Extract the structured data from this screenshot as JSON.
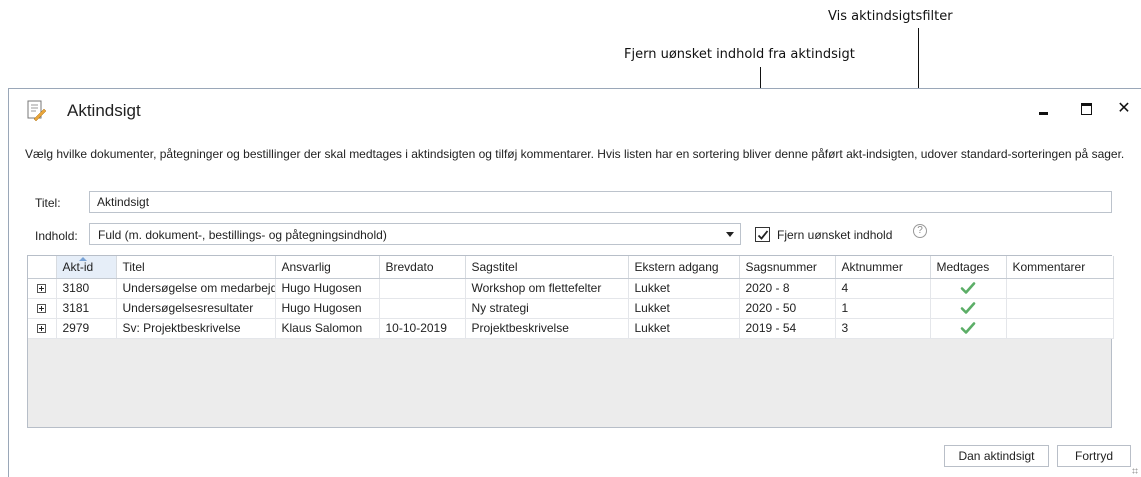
{
  "annotations": {
    "filter_label": "Vis aktindsigtsfilter",
    "remove_label": "Fjern uønsket indhold fra aktindsigt"
  },
  "window": {
    "title": "Aktindsigt",
    "icon": "document-edit-icon",
    "close_glyph": "✕"
  },
  "description": "Vælg hvilke dokumenter, påtegninger og bestillinger der skal medtages i aktindsigten og tilføj kommentarer. Hvis listen har en sortering bliver denne påført akt-indsigten, udover standard-sorteringen på sager.",
  "form": {
    "titel_label": "Titel:",
    "titel_value": "Aktindsigt",
    "indhold_label": "Indhold:",
    "indhold_value": "Fuld (m. dokument-, bestillings- og påtegningsindhold)",
    "remove_checkbox_label": "Fjern uønsket indhold",
    "remove_checked": true,
    "help_glyph": "?"
  },
  "table": {
    "columns": [
      "Akt-id",
      "Titel",
      "Ansvarlig",
      "Brevdato",
      "Sagstitel",
      "Ekstern adgang",
      "Sagsnummer",
      "Aktnummer",
      "Medtages",
      "Kommentarer"
    ],
    "rows": [
      {
        "akt_id": "3180",
        "titel": "Undersøgelse om medarbejdere",
        "ansvarlig": "Hugo Hugosen",
        "brevdato": "",
        "sagstitel": "Workshop om flettefelter",
        "ekstern": "Lukket",
        "sagsnummer": "2020 - 8",
        "aktnummer": "4",
        "medtages": true,
        "kommentarer": ""
      },
      {
        "akt_id": "3181",
        "titel": "Undersøgelsesresultater",
        "ansvarlig": "Hugo Hugosen",
        "brevdato": "",
        "sagstitel": "Ny strategi",
        "ekstern": "Lukket",
        "sagsnummer": "2020 - 50",
        "aktnummer": "1",
        "medtages": true,
        "kommentarer": ""
      },
      {
        "akt_id": "2979",
        "titel": "Sv: Projektbeskrivelse",
        "ansvarlig": "Klaus Salomon",
        "brevdato": "10-10-2019",
        "sagstitel": "Projektbeskrivelse",
        "ekstern": "Lukket",
        "sagsnummer": "2019 - 54",
        "aktnummer": "3",
        "medtages": true,
        "kommentarer": ""
      }
    ]
  },
  "buttons": {
    "ok": "Dan aktindsigt",
    "cancel": "Fortryd"
  },
  "colors": {
    "check_green": "#5cae67",
    "accent": "#7aa3d6"
  }
}
